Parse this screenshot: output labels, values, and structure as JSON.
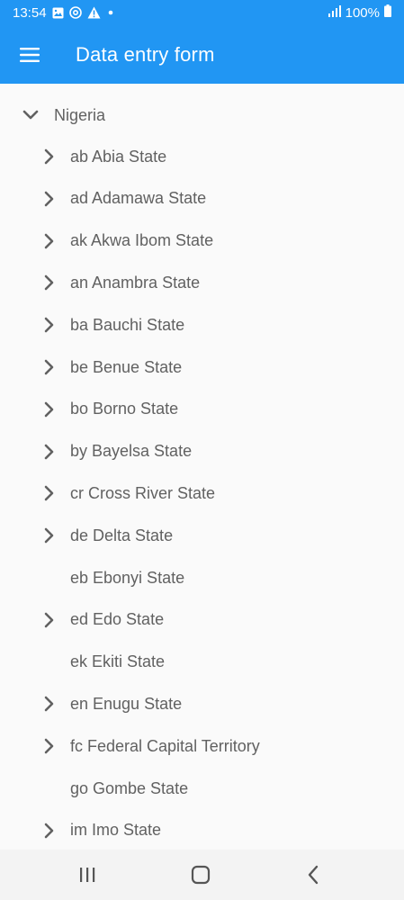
{
  "status_bar": {
    "time": "13:54",
    "battery": "100%",
    "icons": [
      "image-icon",
      "at-sign-icon",
      "warning-icon",
      "dot-icon",
      "signal-icon",
      "battery-icon"
    ]
  },
  "app_bar": {
    "title": "Data entry form",
    "menu_icon": "hamburger-menu-icon"
  },
  "tree": {
    "root": {
      "label": "Nigeria",
      "expanded": true
    },
    "items": [
      {
        "label": "ab Abia State",
        "expandable": true
      },
      {
        "label": "ad Adamawa State",
        "expandable": true
      },
      {
        "label": "ak Akwa Ibom State",
        "expandable": true
      },
      {
        "label": "an Anambra State",
        "expandable": true
      },
      {
        "label": "ba Bauchi State",
        "expandable": true
      },
      {
        "label": "be Benue State",
        "expandable": true
      },
      {
        "label": "bo Borno State",
        "expandable": true
      },
      {
        "label": "by Bayelsa State",
        "expandable": true
      },
      {
        "label": "cr Cross River State",
        "expandable": true
      },
      {
        "label": "de Delta State",
        "expandable": true
      },
      {
        "label": "eb Ebonyi State",
        "expandable": false
      },
      {
        "label": "ed Edo State",
        "expandable": true
      },
      {
        "label": "ek Ekiti State",
        "expandable": false
      },
      {
        "label": "en Enugu State",
        "expandable": true
      },
      {
        "label": "fc Federal Capital Territory",
        "expandable": true
      },
      {
        "label": "go Gombe State",
        "expandable": false
      },
      {
        "label": "im Imo State",
        "expandable": true
      }
    ]
  },
  "nav_bar": {
    "buttons": [
      "recents-icon",
      "home-icon",
      "back-icon"
    ]
  },
  "colors": {
    "primary": "#2196f3",
    "text": "#616161",
    "background": "#fafafa",
    "chevron": "#616161"
  }
}
